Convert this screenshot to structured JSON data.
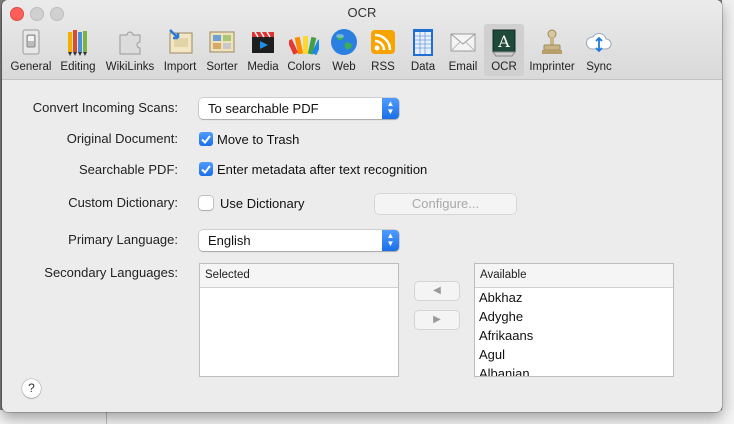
{
  "window": {
    "title": "OCR"
  },
  "toolbar": {
    "items": [
      {
        "label": "General",
        "icon": "general-switch-icon"
      },
      {
        "label": "Editing",
        "icon": "pencils-icon"
      },
      {
        "label": "WikiLinks",
        "icon": "puzzle-icon"
      },
      {
        "label": "Import",
        "icon": "import-icon"
      },
      {
        "label": "Sorter",
        "icon": "sorter-icon"
      },
      {
        "label": "Media",
        "icon": "clapperboard-icon"
      },
      {
        "label": "Colors",
        "icon": "color-swatches-icon"
      },
      {
        "label": "Web",
        "icon": "globe-icon"
      },
      {
        "label": "RSS",
        "icon": "rss-icon"
      },
      {
        "label": "Data",
        "icon": "spreadsheet-icon"
      },
      {
        "label": "Email",
        "icon": "envelope-icon"
      },
      {
        "label": "OCR",
        "icon": "ocr-icon",
        "selected": true
      },
      {
        "label": "Imprinter",
        "icon": "stamp-icon"
      },
      {
        "label": "Sync",
        "icon": "cloud-sync-icon"
      }
    ]
  },
  "form": {
    "convert_scans": {
      "label": "Convert Incoming Scans:",
      "value": "To searchable PDF"
    },
    "original_document": {
      "label": "Original Document:",
      "checkbox_label": "Move to Trash",
      "checked": true
    },
    "searchable_pdf": {
      "label": "Searchable PDF:",
      "checkbox_label": "Enter metadata after text recognition",
      "checked": true
    },
    "custom_dictionary": {
      "label": "Custom Dictionary:",
      "checkbox_label": "Use Dictionary",
      "checked": false,
      "configure_label": "Configure..."
    },
    "primary_language": {
      "label": "Primary Language:",
      "value": "English"
    },
    "secondary_languages": {
      "label": "Secondary Languages:",
      "selected_header": "Selected",
      "available_header": "Available",
      "selected": [],
      "available": [
        "Abkhaz",
        "Adyghe",
        "Afrikaans",
        "Agul",
        "Albanian"
      ]
    }
  },
  "help": {
    "label": "?"
  },
  "colors": {
    "accent": "#1a6fe8",
    "close": "#fc5f57"
  }
}
